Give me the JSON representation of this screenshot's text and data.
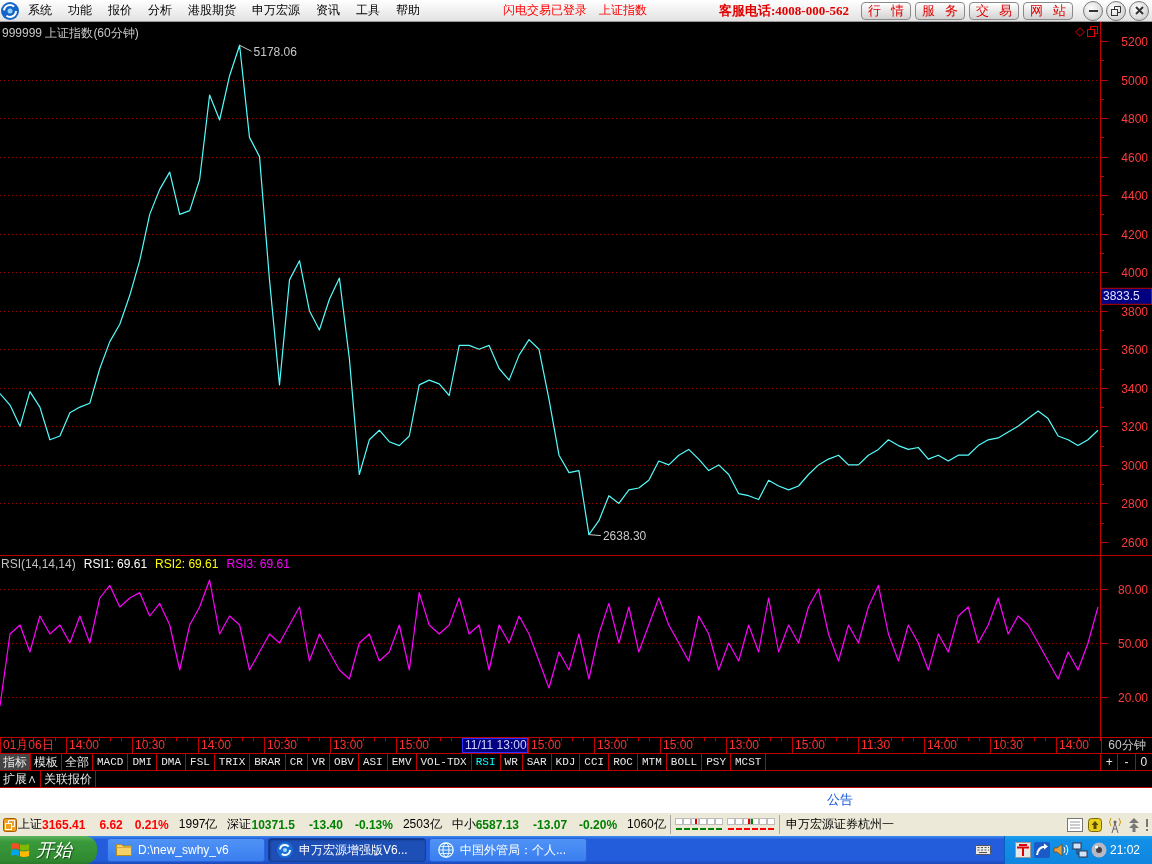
{
  "menu_bar": {
    "items": [
      "系统",
      "功能",
      "报价",
      "分析",
      "港股期货",
      "申万宏源",
      "资讯",
      "工具",
      "帮助"
    ],
    "notices": [
      "闪电交易已登录",
      "上证指数"
    ],
    "hotline": "客服电话:4008-000-562",
    "buttons": [
      "行 情",
      "服 务",
      "交 易",
      "网 站"
    ]
  },
  "price_chart": {
    "cursor_price": "3833.5",
    "chart_data": {
      "type": "line",
      "title": "999999 上证指数(60分钟)",
      "ylim": [
        2532,
        5299
      ],
      "yticks": [
        2600,
        2800,
        3000,
        3200,
        3400,
        3600,
        3800,
        4000,
        4200,
        4400,
        4600,
        4800,
        5000,
        5200
      ],
      "grid": true,
      "series": [
        {
          "color": "#54fcfc",
          "values": [
            3370,
            3310,
            3200,
            3380,
            3300,
            3130,
            3150,
            3270,
            3300,
            3320,
            3500,
            3640,
            3730,
            3880,
            4060,
            4300,
            4430,
            4520,
            4300,
            4320,
            4480,
            4920,
            4790,
            5020,
            5178,
            4700,
            4600,
            3960,
            3415,
            3960,
            4060,
            3800,
            3700,
            3860,
            3970,
            3550,
            2950,
            3130,
            3180,
            3120,
            3100,
            3150,
            3415,
            3440,
            3420,
            3360,
            3620,
            3620,
            3600,
            3620,
            3500,
            3440,
            3570,
            3650,
            3600,
            3340,
            3050,
            2960,
            2970,
            2638,
            2710,
            2840,
            2800,
            2870,
            2880,
            2920,
            3020,
            3000,
            3050,
            3080,
            3030,
            2970,
            3000,
            2950,
            2850,
            2840,
            2820,
            2920,
            2890,
            2870,
            2890,
            2950,
            3000,
            3030,
            3050,
            3000,
            3000,
            3050,
            3080,
            3130,
            3100,
            3080,
            3090,
            3030,
            3050,
            3020,
            3050,
            3050,
            3100,
            3130,
            3140,
            3170,
            3200,
            3240,
            3280,
            3240,
            3150,
            3130,
            3100,
            3130,
            3180
          ]
        }
      ],
      "annotations": [
        "5178.06",
        "2638.30"
      ]
    }
  },
  "rsi_chart": {
    "legend": [
      {
        "text": "RSI(14,14,14)",
        "color": "#c0c0c0"
      },
      {
        "text": "RSI1: 69.61",
        "color": "#ffffff"
      },
      {
        "text": "RSI2: 69.61",
        "color": "#ffff00"
      },
      {
        "text": "RSI3: 69.61",
        "color": "#ff00ff"
      }
    ],
    "chart_data": {
      "type": "line",
      "ylim": [
        -2.2,
        98.9
      ],
      "yticks": [
        {
          "value": 20,
          "label": "20.00"
        },
        {
          "value": 50,
          "label": "50.00"
        },
        {
          "value": 80,
          "label": "80.00"
        }
      ],
      "grid": true,
      "series": [
        {
          "color": "#ff00ff",
          "values": [
            15,
            55,
            60,
            45,
            65,
            55,
            60,
            50,
            65,
            50,
            75,
            82,
            70,
            75,
            78,
            65,
            72,
            60,
            35,
            60,
            70,
            85,
            55,
            65,
            60,
            35,
            45,
            55,
            50,
            60,
            70,
            40,
            55,
            45,
            35,
            30,
            50,
            55,
            40,
            45,
            60,
            35,
            78,
            60,
            55,
            60,
            75,
            55,
            60,
            35,
            60,
            50,
            65,
            55,
            40,
            25,
            45,
            35,
            55,
            30,
            55,
            72,
            50,
            70,
            45,
            60,
            75,
            60,
            50,
            40,
            65,
            55,
            35,
            50,
            40,
            60,
            45,
            75,
            45,
            60,
            50,
            70,
            80,
            55,
            40,
            60,
            50,
            70,
            82,
            55,
            40,
            60,
            50,
            35,
            55,
            45,
            65,
            70,
            50,
            60,
            75,
            55,
            65,
            60,
            50,
            40,
            30,
            45,
            35,
            50,
            70
          ]
        }
      ]
    }
  },
  "time_axis": {
    "labels": [
      {
        "text": "01月06日",
        "kind": "tick"
      },
      {
        "text": "14:00",
        "kind": "tick"
      },
      {
        "text": "10:30",
        "kind": "tick"
      },
      {
        "text": "14:00",
        "kind": "tick"
      },
      {
        "text": "10:30",
        "kind": "tick"
      },
      {
        "text": "13:00",
        "kind": "tick"
      },
      {
        "text": "15:00",
        "kind": "tick"
      },
      {
        "text": "11/11 13:00",
        "kind": "cursor"
      },
      {
        "text": "15:00",
        "kind": "tick"
      },
      {
        "text": "13:00",
        "kind": "tick"
      },
      {
        "text": "15:00",
        "kind": "tick"
      },
      {
        "text": "13:00",
        "kind": "tick"
      },
      {
        "text": "15:00",
        "kind": "tick"
      },
      {
        "text": "11:30",
        "kind": "tick"
      },
      {
        "text": "14:00",
        "kind": "tick"
      },
      {
        "text": "10:30",
        "kind": "tick"
      },
      {
        "text": "14:00",
        "kind": "tick"
      }
    ],
    "period": "60分钟"
  },
  "indicator_bar": {
    "panel_tabs": [
      {
        "label": "指标",
        "selected": true
      },
      {
        "label": "模板",
        "selected": false
      },
      {
        "label": "全部",
        "selected": false
      }
    ],
    "indicators": [
      {
        "label": "MACD",
        "selected": false
      },
      {
        "label": "DMI",
        "selected": false
      },
      {
        "label": "DMA",
        "selected": false
      },
      {
        "label": "FSL",
        "selected": false
      },
      {
        "label": "TRIX",
        "selected": false
      },
      {
        "label": "BRAR",
        "selected": false
      },
      {
        "label": "CR",
        "selected": false
      },
      {
        "label": "VR",
        "selected": false
      },
      {
        "label": "OBV",
        "selected": false
      },
      {
        "label": "ASI",
        "selected": false
      },
      {
        "label": "EMV",
        "selected": false
      },
      {
        "label": "VOL-TDX",
        "selected": false
      },
      {
        "label": "RSI",
        "selected": true
      },
      {
        "label": "WR",
        "selected": false
      },
      {
        "label": "SAR",
        "selected": false
      },
      {
        "label": "KDJ",
        "selected": false
      },
      {
        "label": "CCI",
        "selected": false
      },
      {
        "label": "ROC",
        "selected": false
      },
      {
        "label": "MTM",
        "selected": false
      },
      {
        "label": "BOLL",
        "selected": false
      },
      {
        "label": "PSY",
        "selected": false
      },
      {
        "label": "MCST",
        "selected": false
      }
    ],
    "zoom_buttons": [
      "+",
      "-",
      "0"
    ]
  },
  "extension_bar": {
    "tabs": [
      "扩展∧",
      "关联报价"
    ]
  },
  "announcement": "公告",
  "status_bar": {
    "indices": [
      {
        "name": "上证",
        "value": "3165.41",
        "change": "6.62",
        "percent": "0.21%",
        "turnover": "1997亿",
        "color": "#ff0000"
      },
      {
        "name": "深证",
        "value": "10371.5",
        "change": "-13.40",
        "percent": "-0.13%",
        "turnover": "2503亿",
        "color": "#008000"
      },
      {
        "name": "中小",
        "value": "6587.13",
        "change": "-13.07",
        "percent": "-0.20%",
        "turnover": "1060亿",
        "color": "#008000"
      }
    ],
    "broker": "申万宏源证券杭州一"
  },
  "taskbar": {
    "start": "开始",
    "tasks": [
      {
        "label": "D:\\new_swhy_v6",
        "kind": "folder",
        "selected": false
      },
      {
        "label": "申万宏源增强版V6...",
        "kind": "app",
        "selected": true
      },
      {
        "label": "中国外管局：个人...",
        "kind": "browser",
        "selected": false
      }
    ],
    "clock": "21:02"
  }
}
